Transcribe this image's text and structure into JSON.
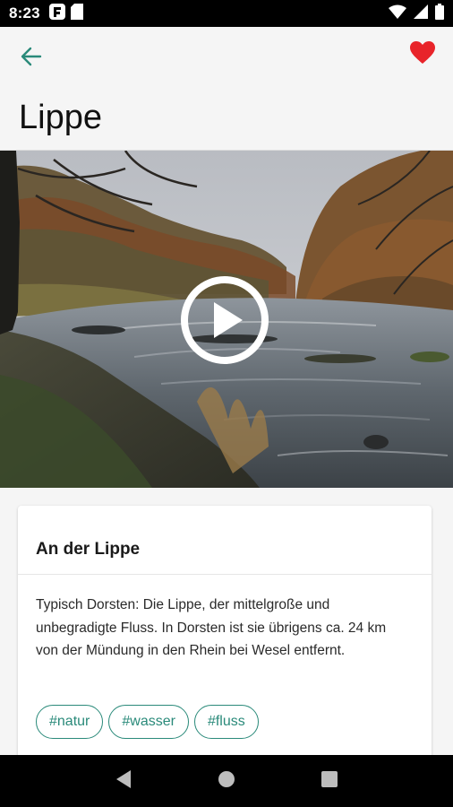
{
  "status_bar": {
    "time": "8:23",
    "left_icons": [
      "flipboard-icon",
      "sd-card-icon"
    ],
    "right_icons": [
      "wifi-icon",
      "signal-icon",
      "battery-icon"
    ]
  },
  "app_bar": {
    "title": "Lippe",
    "back_icon": "arrow-left-icon",
    "favorite_icon": "heart-filled-icon",
    "accent_color": "#2a8a7a",
    "favorite_color": "#e8242a"
  },
  "hero": {
    "media_type": "video",
    "play_icon": "play-circle-icon"
  },
  "card": {
    "title": "An der Lippe",
    "description": "Typisch Dorsten: Die Lippe, der mittelgroße und unbegradigte Fluss. In Dorsten ist sie übrigens ca. 24 km von der Mündung in den Rhein bei Wesel entfernt.",
    "tags": [
      "#natur",
      "#wasser",
      "#fluss"
    ]
  },
  "nav_bar": {
    "buttons": [
      "back-triangle-icon",
      "home-circle-icon",
      "recents-square-icon"
    ]
  }
}
